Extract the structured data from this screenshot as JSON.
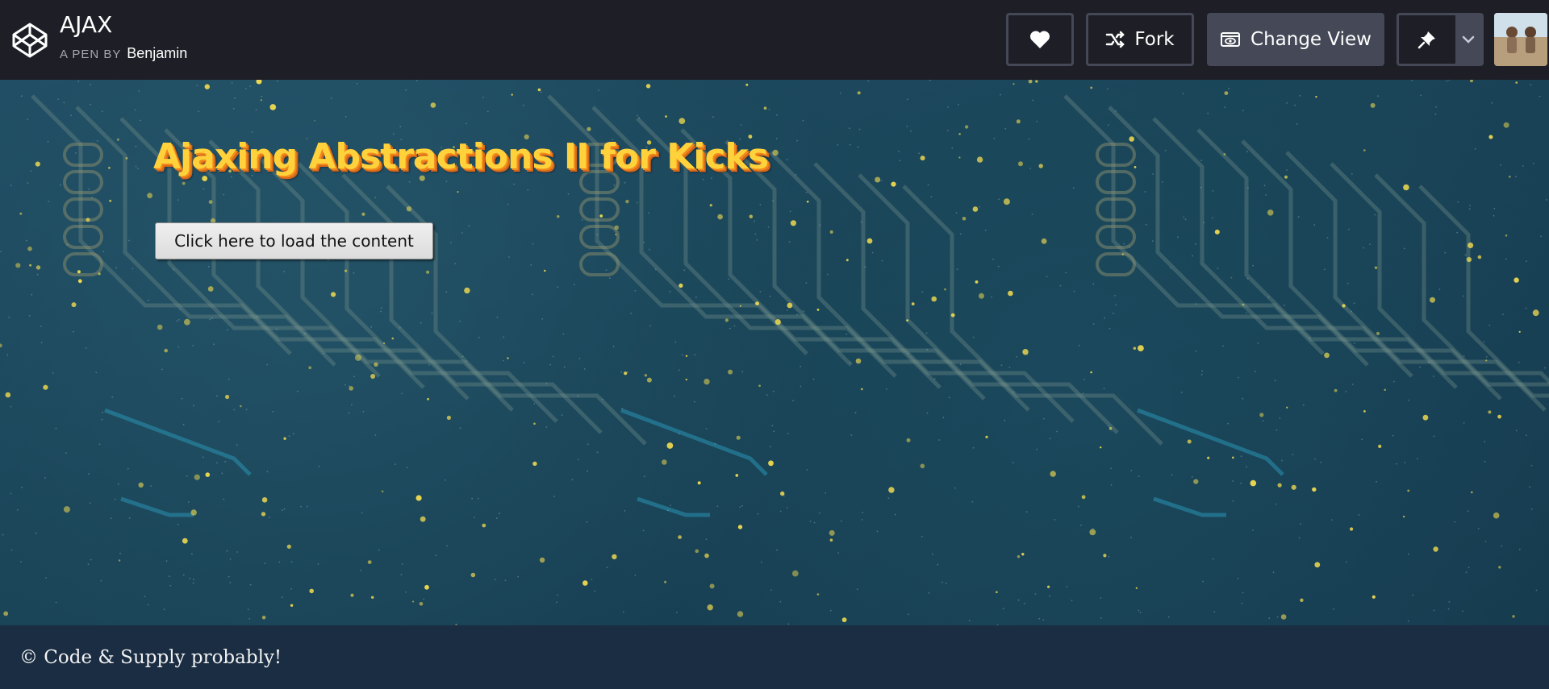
{
  "header": {
    "logo_icon": "codepen-logo-icon",
    "title": "AJAX",
    "pen_by_label": "A PEN BY",
    "author": "Benjamin",
    "buttons": {
      "heart_icon": "heart-icon",
      "fork_label": "Fork",
      "fork_icon": "fork-icon",
      "change_view_label": "Change View",
      "change_view_icon": "eye-window-icon",
      "pin_icon": "pin-icon",
      "dropdown_icon": "chevron-down-icon"
    },
    "avatar_icon": "user-avatar"
  },
  "preview": {
    "heading": "Ajaxing Abstractions II for Kicks",
    "load_button_label": "Click here to load the content"
  },
  "footer": {
    "text": "© Code & Supply probably!"
  },
  "colors": {
    "header_bg": "#1e1f26",
    "button_border": "#444857",
    "heading_yellow": "#ffd23c",
    "heading_shadow": "#f08a1c",
    "preview_bg": "#1a4458",
    "footer_bg": "#1a2d42"
  }
}
